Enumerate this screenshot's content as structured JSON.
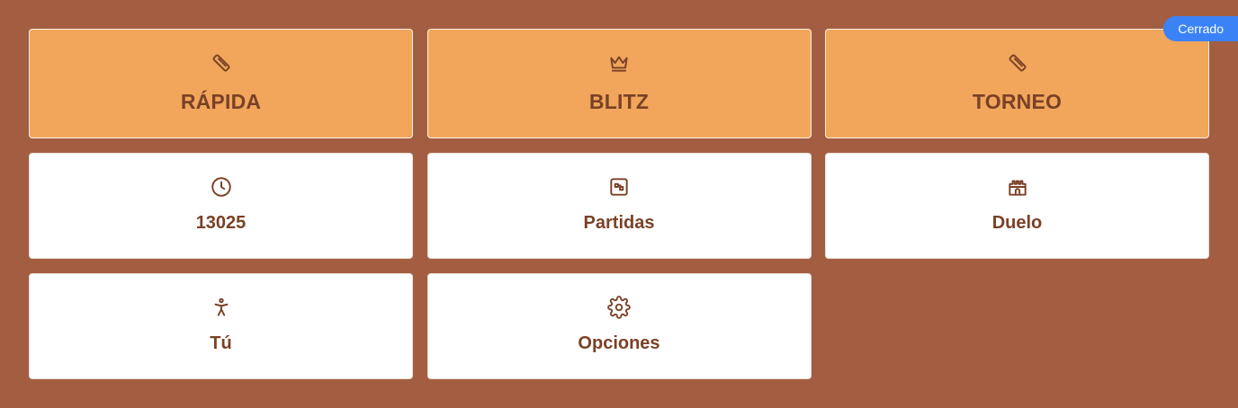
{
  "badge": {
    "label": "Cerrado",
    "color": "#3b82f6"
  },
  "colors": {
    "background": "#a35e42",
    "primary_card": "#f1a65c",
    "secondary_card": "#ffffff",
    "text": "#7a4126"
  },
  "cards": [
    {
      "label": "RÁPIDA",
      "icon": "ruler-icon",
      "style": "primary"
    },
    {
      "label": "BLITZ",
      "icon": "crown-icon",
      "style": "primary"
    },
    {
      "label": "TORNEO",
      "icon": "ruler-icon",
      "style": "primary"
    },
    {
      "label": "13025",
      "icon": "clock-icon",
      "style": "secondary"
    },
    {
      "label": "Partidas",
      "icon": "board-icon",
      "style": "secondary"
    },
    {
      "label": "Duelo",
      "icon": "castle-icon",
      "style": "secondary"
    },
    {
      "label": "Tú",
      "icon": "person-icon",
      "style": "secondary"
    },
    {
      "label": "Opciones",
      "icon": "gear-icon",
      "style": "secondary"
    }
  ]
}
